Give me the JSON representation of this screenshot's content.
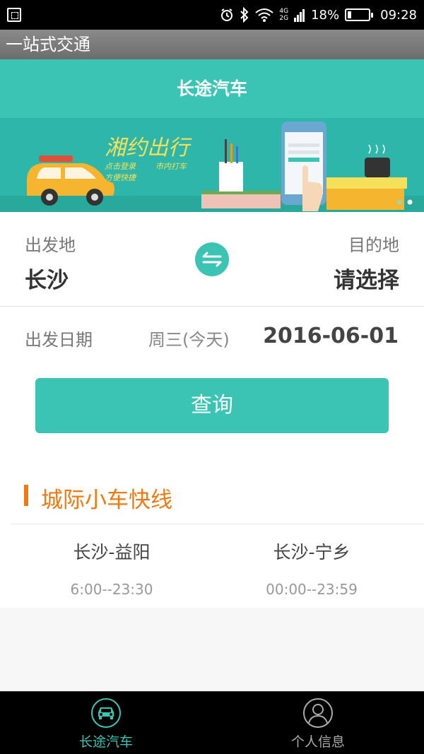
{
  "status_bar": {
    "network": [
      "4G",
      "2G"
    ],
    "battery": "18%",
    "battery_level": 0.18,
    "time": "09:28",
    "icons": [
      "screenshot-icon",
      "alarm-icon",
      "bluetooth-icon",
      "wifi-icon",
      "signal-icon",
      "battery-icon"
    ]
  },
  "app": {
    "title": "一站式交通"
  },
  "header": {
    "title": "长途汽车"
  },
  "banner": {
    "slogan": "湘约出行",
    "tagline_1": "点击登录",
    "tagline_2": "市内打车",
    "tagline_3": "方便快捷",
    "accent_color": "#2fb6aa"
  },
  "trip": {
    "origin_label": "出发地",
    "origin_value": "长沙",
    "destination_label": "目的地",
    "destination_value": "请选择",
    "date_label": "出发日期",
    "weekday": "周三(今天)",
    "date": "2016-06-01",
    "query_button": "查询"
  },
  "section": {
    "title": "城际小车快线",
    "accent_color": "#f07a12"
  },
  "routes": [
    {
      "name": "长沙-益阳",
      "time": "6:00--23:30"
    },
    {
      "name": "长沙-宁乡",
      "time": "00:00--23:59"
    }
  ],
  "bottom_nav": {
    "items": [
      {
        "label": "长途汽车",
        "icon": "car-icon",
        "active": true
      },
      {
        "label": "个人信息",
        "icon": "user-icon",
        "active": false
      }
    ]
  },
  "colors": {
    "primary": "#3bc3b4",
    "active_nav": "#3bc3b4",
    "inactive_nav": "#aaaaaa"
  }
}
